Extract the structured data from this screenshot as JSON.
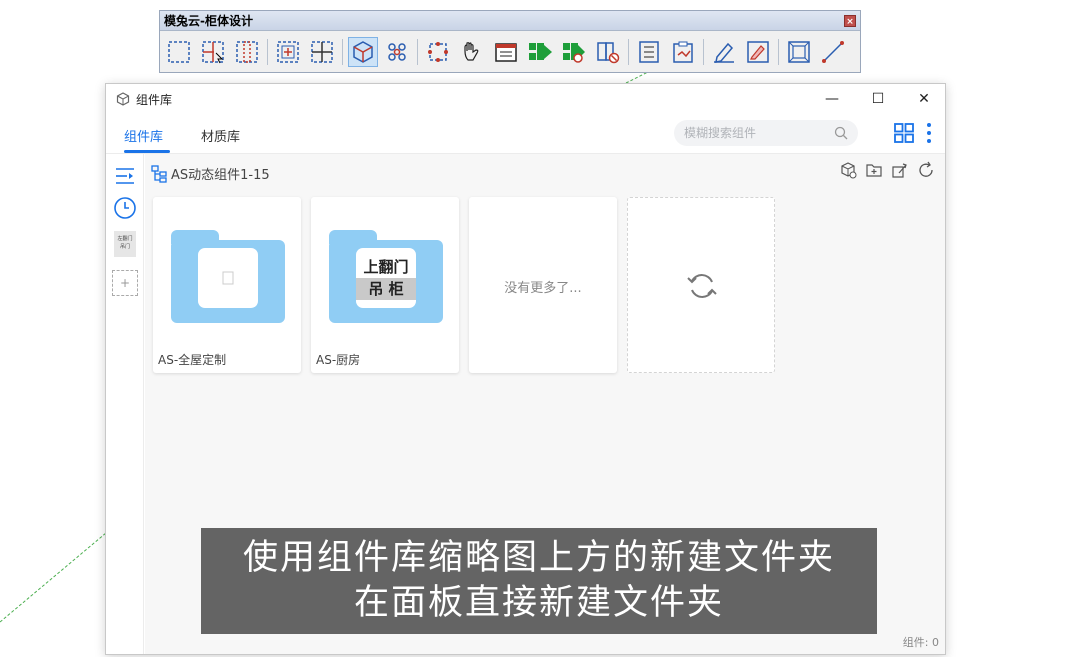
{
  "toolbar_window": {
    "title": "模兔云-柜体设计",
    "close_symbol": "×",
    "tools": [
      {
        "icon": "select-rect-icon"
      },
      {
        "icon": "select-part-icon"
      },
      {
        "icon": "select-column-icon"
      },
      {
        "icon": "add-cabinet-icon"
      },
      {
        "icon": "split-cabinet-icon"
      },
      {
        "icon": "component-3d-icon",
        "active": true
      },
      {
        "icon": "component-cluster-icon"
      },
      {
        "icon": "board-select-icon"
      },
      {
        "icon": "hand-tool-icon"
      },
      {
        "icon": "panel-list-icon"
      },
      {
        "icon": "export-green-icon"
      },
      {
        "icon": "export-process-icon"
      },
      {
        "icon": "delete-part-icon"
      },
      {
        "icon": "list-report-icon"
      },
      {
        "icon": "clipboard-report-icon"
      },
      {
        "icon": "pencil-edit-icon"
      },
      {
        "icon": "pencil-box-icon"
      },
      {
        "icon": "frame-select-icon"
      },
      {
        "icon": "dimension-icon"
      }
    ]
  },
  "window": {
    "title": "组件库",
    "controls": {
      "minimize": "—",
      "maximize": "☐",
      "close": "✕"
    }
  },
  "tabs": [
    {
      "label": "组件库",
      "active": true
    },
    {
      "label": "材质库",
      "active": false
    }
  ],
  "search": {
    "placeholder": "模糊搜索组件"
  },
  "sidebar": {
    "thumb_lines": [
      "左翻门",
      "吊门"
    ]
  },
  "breadcrumb": "AS动态组件1-15",
  "cards": [
    {
      "type": "folder",
      "label": "AS-全屋定制",
      "thumb": "empty"
    },
    {
      "type": "folder",
      "label": "AS-厨房",
      "thumb_lines": [
        "上翻门",
        "吊 柜"
      ]
    },
    {
      "type": "more",
      "text": "没有更多了..."
    },
    {
      "type": "refresh"
    }
  ],
  "status": "组件: 0",
  "subtitle": {
    "line1": "使用组件库缩略图上方的新建文件夹",
    "line2": "在面板直接新建文件夹"
  },
  "colors": {
    "accent": "#1a73e8",
    "folder": "#90cdf4"
  }
}
